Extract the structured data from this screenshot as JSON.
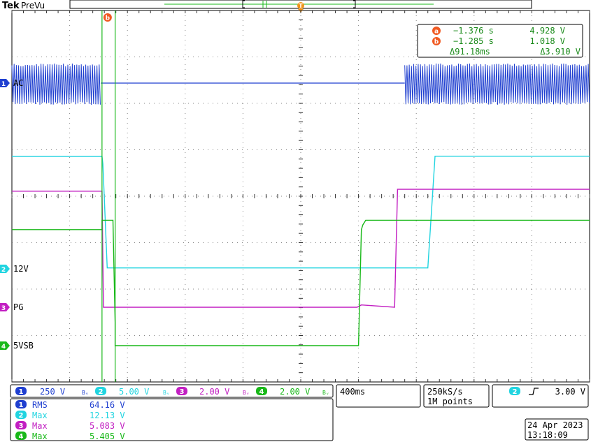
{
  "header": {
    "brand": "Tek",
    "mode": "PreVu",
    "trigger_marker": "T"
  },
  "cursors": {
    "a_label": "a",
    "b_label": "b",
    "a_time": "−1.376 s",
    "a_volt": "4.928 V",
    "b_time": "−1.285 s",
    "b_volt": "1.018 V",
    "delta_time": "Δ91.18ms",
    "delta_volt": "Δ3.910 V"
  },
  "channels": [
    {
      "num": "1",
      "name": "AC",
      "scale": "250 V",
      "color": "#1f3fd0",
      "bw": "Bᵥ"
    },
    {
      "num": "2",
      "name": "12V",
      "scale": "5.00 V",
      "color": "#20d4e0",
      "bw": "Bᵥ"
    },
    {
      "num": "3",
      "name": "PG",
      "scale": "2.00 V",
      "color": "#c21fc2",
      "bw": "Bᵥ"
    },
    {
      "num": "4",
      "name": "5VSB",
      "scale": "2.00 V",
      "color": "#18b818",
      "bw": "Bᵥ"
    }
  ],
  "timebase": "400ms",
  "sample": {
    "rate": "250kS/s",
    "points": "1M points"
  },
  "trigger": {
    "channel": "2",
    "slope_icon": "rising-edge-icon",
    "level": "3.00 V"
  },
  "measurements": [
    {
      "num": "1",
      "name": "RMS",
      "value": "64.16 V",
      "color": "#1f3fd0"
    },
    {
      "num": "2",
      "name": "Max",
      "value": "12.13 V",
      "color": "#20d4e0"
    },
    {
      "num": "3",
      "name": "Max",
      "value": "5.083 V",
      "color": "#c21fc2"
    },
    {
      "num": "4",
      "name": "Max",
      "value": "5.405 V",
      "color": "#18b818"
    }
  ],
  "datetime": {
    "date": "24 Apr 2023",
    "time": "13:18:09"
  },
  "chart_data": {
    "type": "line",
    "x_unit": "s",
    "x_divisions": 10,
    "y_divisions": 8,
    "time_per_div": 0.4,
    "grid": true,
    "series": [
      {
        "name": "AC",
        "kind": "ac_burst",
        "color": "#1f3fd0",
        "segments": [
          [
            -2.0,
            -1.385,
            "ac"
          ],
          [
            -1.385,
            0.72,
            "flat"
          ],
          [
            0.72,
            2.0,
            "ac"
          ]
        ]
      },
      {
        "name": "12V",
        "kind": "steps",
        "color": "#20d4e0",
        "points": [
          [
            -2.0,
            12.1
          ],
          [
            -1.376,
            12.1
          ],
          [
            -1.37,
            11.3
          ],
          [
            -1.34,
            0.1
          ],
          [
            0.88,
            0.1
          ],
          [
            0.93,
            12.13
          ],
          [
            2.0,
            12.13
          ]
        ]
      },
      {
        "name": "PG",
        "kind": "steps",
        "color": "#c21fc2",
        "points": [
          [
            -2.0,
            5.0
          ],
          [
            -1.376,
            5.0
          ],
          [
            -1.366,
            0.0
          ],
          [
            0.39,
            0.0
          ],
          [
            0.42,
            0.1
          ],
          [
            0.65,
            0.0
          ],
          [
            0.67,
            5.08
          ],
          [
            2.0,
            5.08
          ]
        ]
      },
      {
        "name": "5VSB",
        "kind": "steps",
        "color": "#18b818",
        "points": [
          [
            -2.0,
            5.0
          ],
          [
            -1.376,
            5.0
          ],
          [
            -1.376,
            5.4
          ],
          [
            -1.3,
            5.4
          ],
          [
            -1.285,
            1.0
          ],
          [
            -1.285,
            0.0
          ],
          [
            0.4,
            0.0
          ],
          [
            0.42,
            5.0
          ],
          [
            0.43,
            5.2
          ],
          [
            0.45,
            5.4
          ],
          [
            2.0,
            5.4
          ]
        ]
      }
    ],
    "cursor_times": {
      "a": -1.376,
      "b": -1.285
    }
  }
}
